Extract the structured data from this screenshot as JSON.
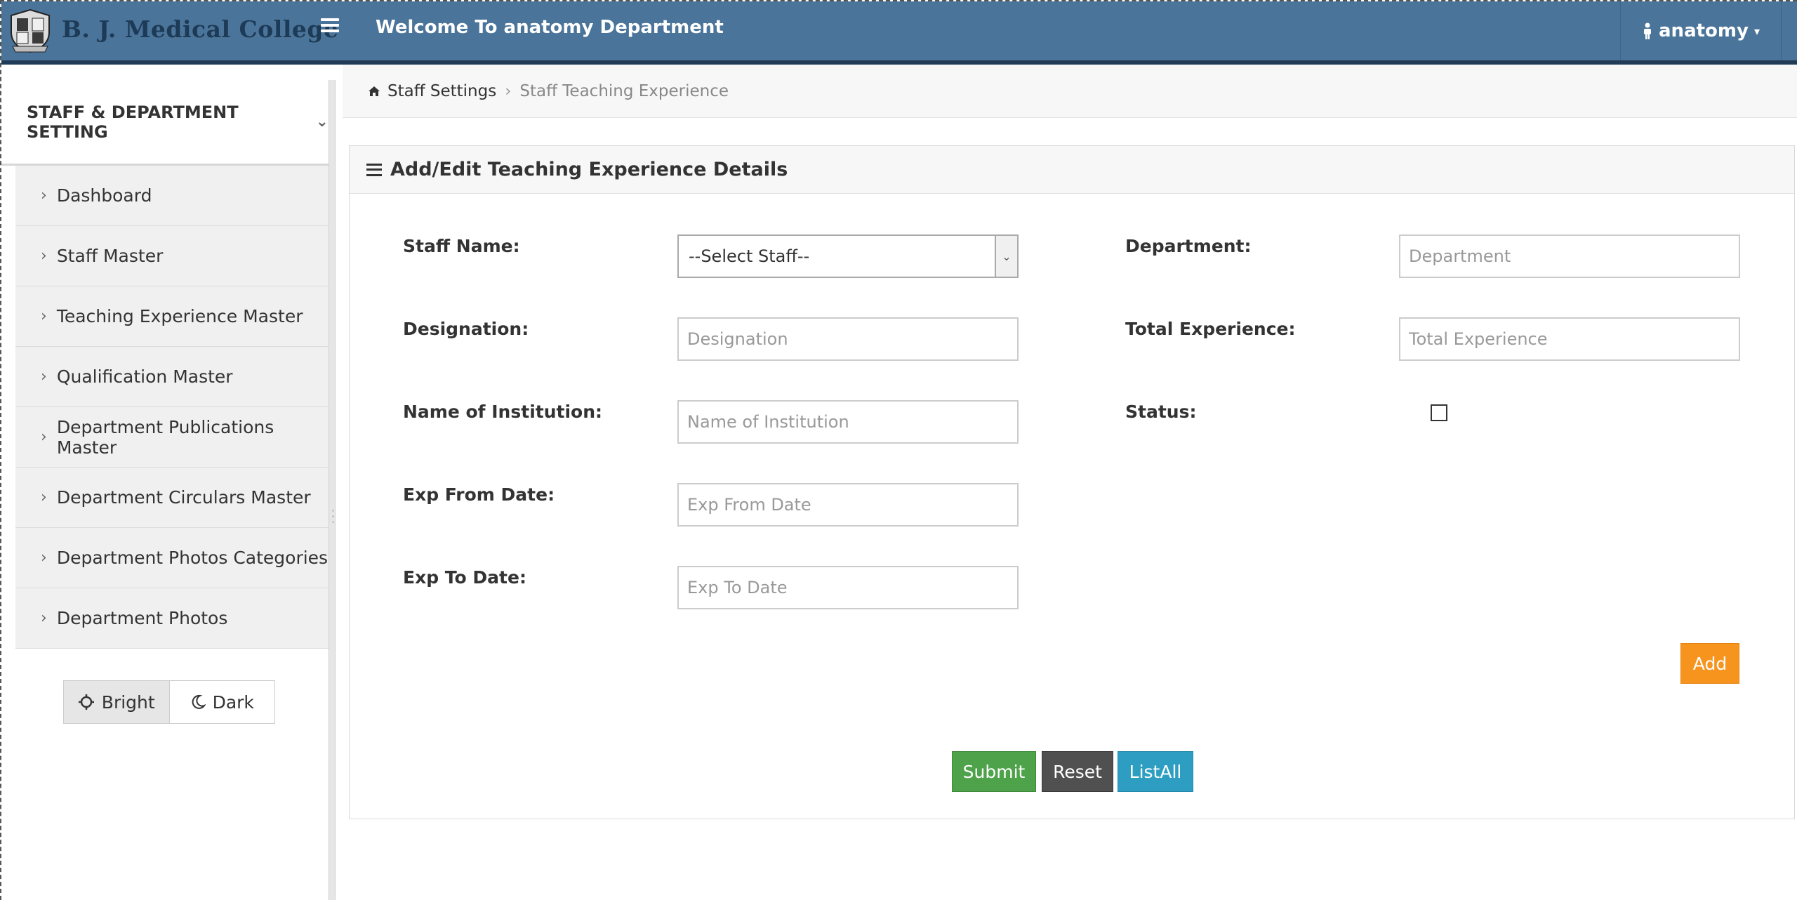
{
  "header": {
    "brand": "B. J. Medical College",
    "welcome": "Welcome To anatomy Department",
    "user": "anatomy"
  },
  "sidebar": {
    "section_title": "STAFF & DEPARTMENT SETTING",
    "items": [
      {
        "label": "Dashboard"
      },
      {
        "label": "Staff Master"
      },
      {
        "label": "Teaching Experience Master"
      },
      {
        "label": "Qualification Master"
      },
      {
        "label": "Department Publications Master"
      },
      {
        "label": "Department Circulars Master"
      },
      {
        "label": "Department Photos Categories"
      },
      {
        "label": "Department Photos"
      }
    ],
    "theme": {
      "bright": "Bright",
      "dark": "Dark",
      "selected": "Bright"
    }
  },
  "breadcrumb": {
    "home": "Staff Settings",
    "current": "Staff Teaching Experience"
  },
  "form": {
    "title": "Add/Edit Teaching Experience Details",
    "staff_name": {
      "label": "Staff Name:",
      "value": "--Select Staff--"
    },
    "department": {
      "label": "Department:",
      "placeholder": "Department"
    },
    "designation": {
      "label": "Designation:",
      "placeholder": "Designation"
    },
    "total_experience": {
      "label": "Total Experience:",
      "placeholder": "Total Experience"
    },
    "institution": {
      "label": "Name of Institution:",
      "placeholder": "Name of Institution"
    },
    "status": {
      "label": "Status:",
      "checked": false
    },
    "exp_from": {
      "label": "Exp From Date:",
      "placeholder": "Exp From Date"
    },
    "exp_to": {
      "label": "Exp To Date:",
      "placeholder": "Exp To Date"
    },
    "add_label": "Add",
    "submit_label": "Submit",
    "reset_label": "Reset",
    "listall_label": "ListAll"
  },
  "colors": {
    "topbar": "#4a7499",
    "add": "#f7941d",
    "submit": "#4ea24a",
    "reset": "#505050",
    "listall": "#2d9ec2"
  }
}
